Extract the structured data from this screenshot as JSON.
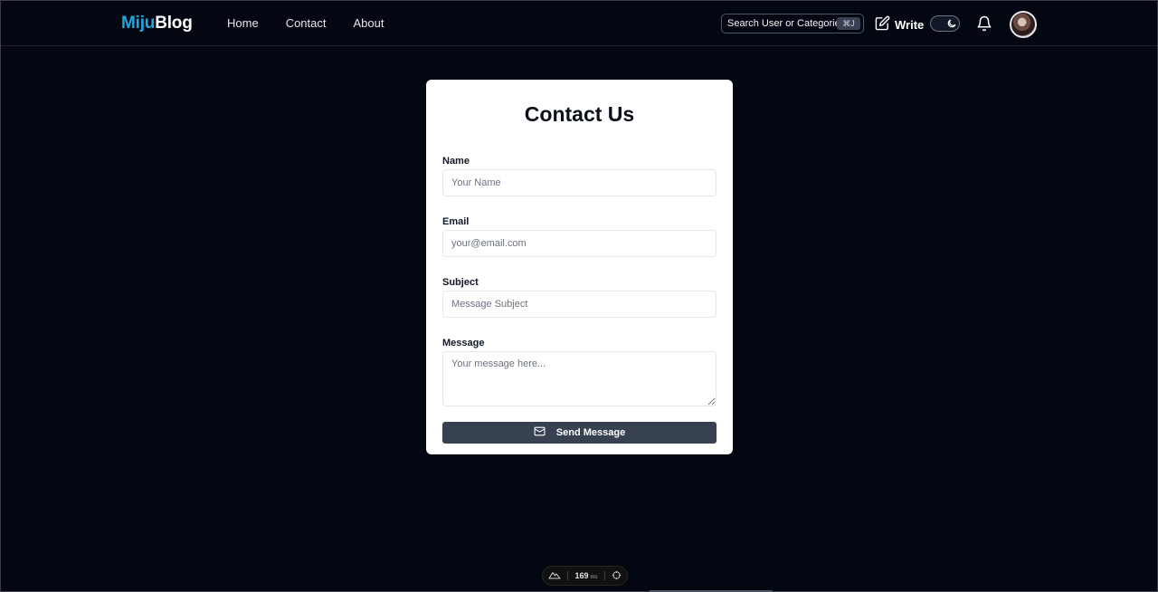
{
  "brand": {
    "part1": "Miju",
    "part2": "Blog"
  },
  "nav": {
    "links": [
      "Home",
      "Contact",
      "About"
    ]
  },
  "header": {
    "search_text": "Search User or Categories...",
    "search_shortcut": "⌘J",
    "write_label": "Write"
  },
  "form": {
    "title": "Contact Us",
    "fields": [
      {
        "label": "Name",
        "placeholder": "Your Name",
        "value": ""
      },
      {
        "label": "Email",
        "placeholder": "your@email.com",
        "value": ""
      },
      {
        "label": "Subject",
        "placeholder": "Message Subject",
        "value": ""
      },
      {
        "label": "Message",
        "placeholder": "Your message here...",
        "value": ""
      }
    ],
    "submit_label": "Send Message"
  },
  "dev_indicator": {
    "value": "169",
    "unit": "ms"
  },
  "colors": {
    "background": "#030712",
    "brand_accent": "#22a6e0",
    "card": "#ffffff",
    "button": "#374151"
  },
  "icons": [
    "search-shortcut",
    "pencil-square-icon",
    "moon-icon",
    "bell-icon",
    "mail-icon",
    "mountain-icon",
    "crosshair-icon"
  ]
}
